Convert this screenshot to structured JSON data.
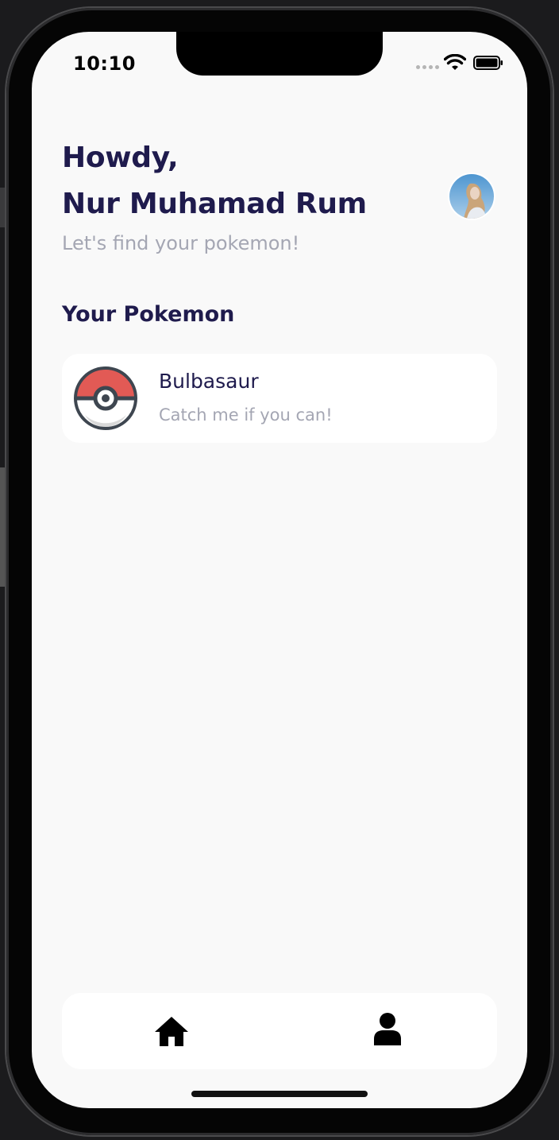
{
  "status_bar": {
    "time": "10:10"
  },
  "header": {
    "greeting": "Howdy,",
    "user_name": "Nur Muhamad Rum",
    "subtitle": "Let's find your pokemon!"
  },
  "section": {
    "title": "Your Pokemon"
  },
  "pokemon_list": [
    {
      "name": "Bulbasaur",
      "description": "Catch me if you can!",
      "icon": "pokeball-icon"
    }
  ],
  "bottom_nav": {
    "items": [
      {
        "icon": "home-icon"
      },
      {
        "icon": "person-icon"
      }
    ]
  },
  "colors": {
    "primary_text": "#1f1b4d",
    "secondary_text": "#a4a6b3",
    "background": "#f9f9f9",
    "card": "#ffffff",
    "pokeball_red": "#e25a55"
  }
}
